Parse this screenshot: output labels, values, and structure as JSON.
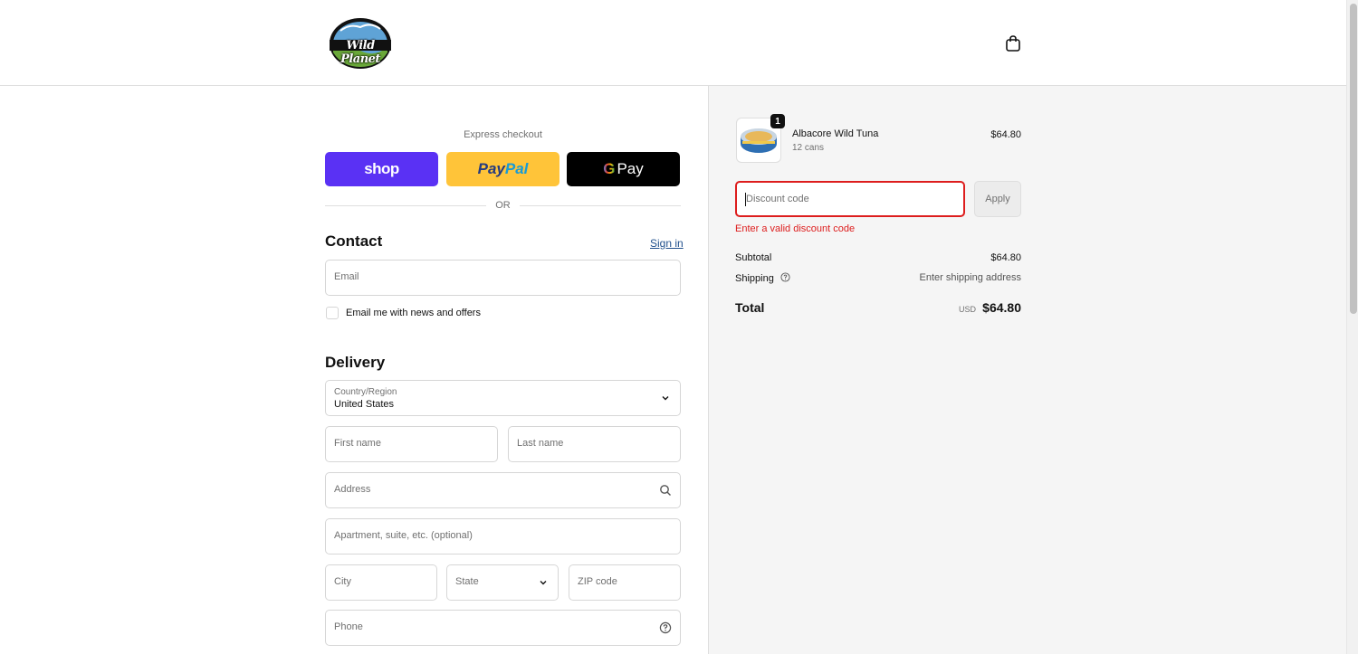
{
  "header": {
    "logo_text": "Wild Planet",
    "cart_icon": "shopping-bag-icon"
  },
  "express": {
    "title": "Express checkout",
    "shop_label": "shop",
    "paypal_label_1": "Pay",
    "paypal_label_2": "Pal",
    "gpay_g": "G",
    "gpay_label": "Pay",
    "or_text": "OR"
  },
  "contact": {
    "title": "Contact",
    "signin_label": "Sign in",
    "email_placeholder": "Email",
    "newsletter_label": "Email me with news and offers"
  },
  "delivery": {
    "title": "Delivery",
    "country_label": "Country/Region",
    "country_value": "United States",
    "first_name_placeholder": "First name",
    "last_name_placeholder": "Last name",
    "address_placeholder": "Address",
    "apartment_placeholder": "Apartment, suite, etc. (optional)",
    "city_placeholder": "City",
    "state_placeholder": "State",
    "zip_placeholder": "ZIP code",
    "phone_placeholder": "Phone"
  },
  "summary": {
    "product": {
      "name": "Albacore Wild Tuna",
      "variant": "12 cans",
      "price": "$64.80",
      "quantity": "1"
    },
    "discount_placeholder": "Discount code",
    "apply_label": "Apply",
    "discount_error": "Enter a valid discount code",
    "subtotal_label": "Subtotal",
    "subtotal_value": "$64.80",
    "shipping_label": "Shipping",
    "shipping_value": "Enter shipping address",
    "total_label": "Total",
    "total_currency": "USD",
    "total_value": "$64.80"
  },
  "colors": {
    "shop_purple": "#5a31f4",
    "paypal_yellow": "#ffc439",
    "error_red": "#dd1d1d",
    "link_blue": "#1f4f8c"
  }
}
